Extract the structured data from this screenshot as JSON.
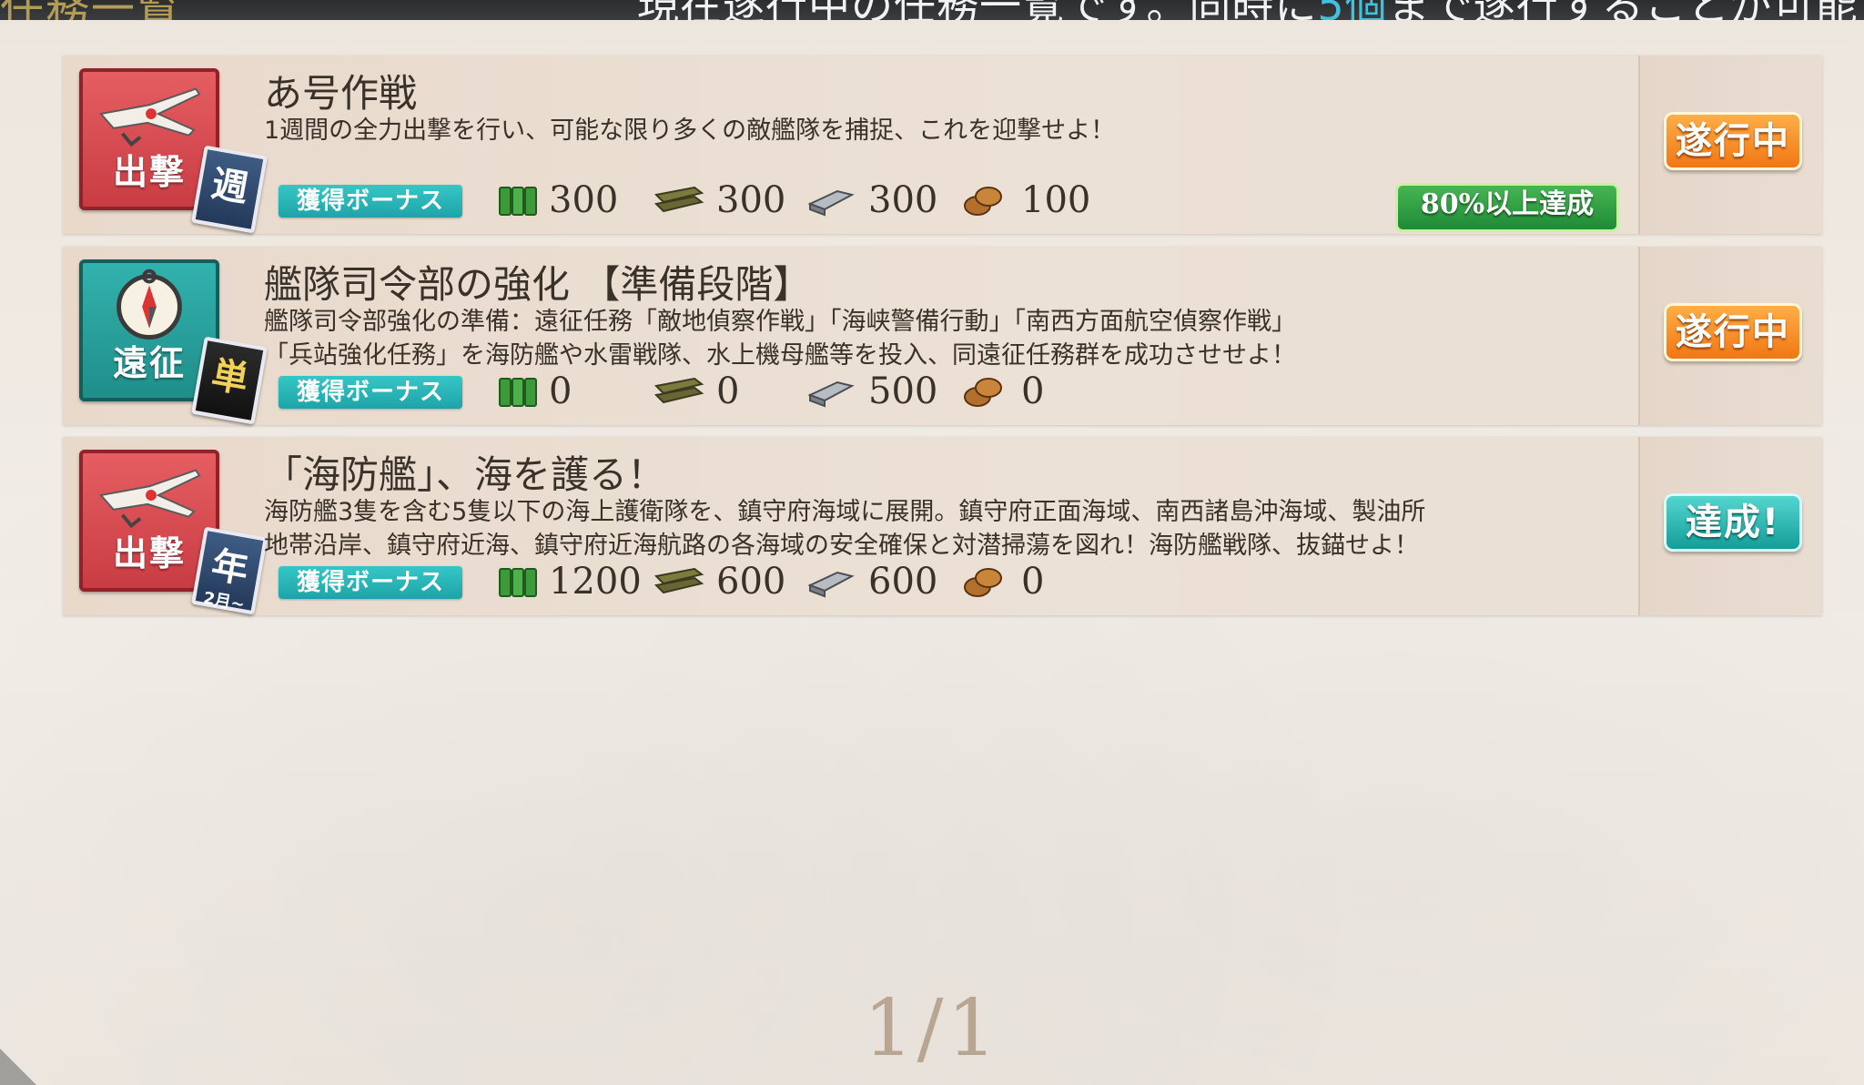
{
  "topbar": {
    "left_text": "任務一覧",
    "right_prefix": "現在遂行中の任務一覧です。同時に",
    "right_highlight": "5個",
    "right_suffix": "まで遂行することが可能です。"
  },
  "quests": [
    {
      "category": "出撃",
      "category_icon": "plane-icon",
      "frequency": "週",
      "frequency_sub": "",
      "title": "あ号作戦",
      "description_line1": "1週間の全力出撃を行い、可能な限り多くの敵艦隊を捕捉、これを迎撃せよ！",
      "description_line2": "",
      "bonus_label": "獲得ボーナス",
      "rewards": {
        "fuel": "300",
        "ammo": "300",
        "steel": "300",
        "bauxite": "100"
      },
      "progress": "80%以上達成",
      "status": "遂行中"
    },
    {
      "category": "遠征",
      "category_icon": "compass-icon",
      "frequency": "単",
      "frequency_sub": "",
      "title": "艦隊司令部の強化 【準備段階】",
      "description_line1": "艦隊司令部強化の準備：遠征任務「敵地偵察作戦」「海峡警備行動」「南西方面航空偵察作戦」",
      "description_line2": "「兵站強化任務」を海防艦や水雷戦隊、水上機母艦等を投入、同遠征任務群を成功させせよ！",
      "bonus_label": "獲得ボーナス",
      "rewards": {
        "fuel": "0",
        "ammo": "0",
        "steel": "500",
        "bauxite": "0"
      },
      "progress": "",
      "status": "遂行中"
    },
    {
      "category": "出撃",
      "category_icon": "plane-icon",
      "frequency": "年",
      "frequency_sub": "2月~",
      "title": "「海防艦」、海を護る！",
      "description_line1": "海防艦3隻を含む5隻以下の海上護衛隊を、鎮守府海域に展開。鎮守府正面海域、南西諸島沖海域、製油所",
      "description_line2": "地帯沿岸、鎮守府近海、鎮守府近海航路の各海域の安全確保と対潜掃蕩を図れ！海防艦戦隊、抜錨せよ！",
      "bonus_label": "獲得ボーナス",
      "rewards": {
        "fuel": "1200",
        "ammo": "600",
        "steel": "600",
        "bauxite": "0"
      },
      "progress": "",
      "status": "達成!"
    }
  ],
  "pager": "1/1",
  "colors": {
    "in_progress": "#f07412",
    "complete": "#119a95",
    "bonus": "#1ea4a8",
    "progress_badge": "#2fa043"
  }
}
